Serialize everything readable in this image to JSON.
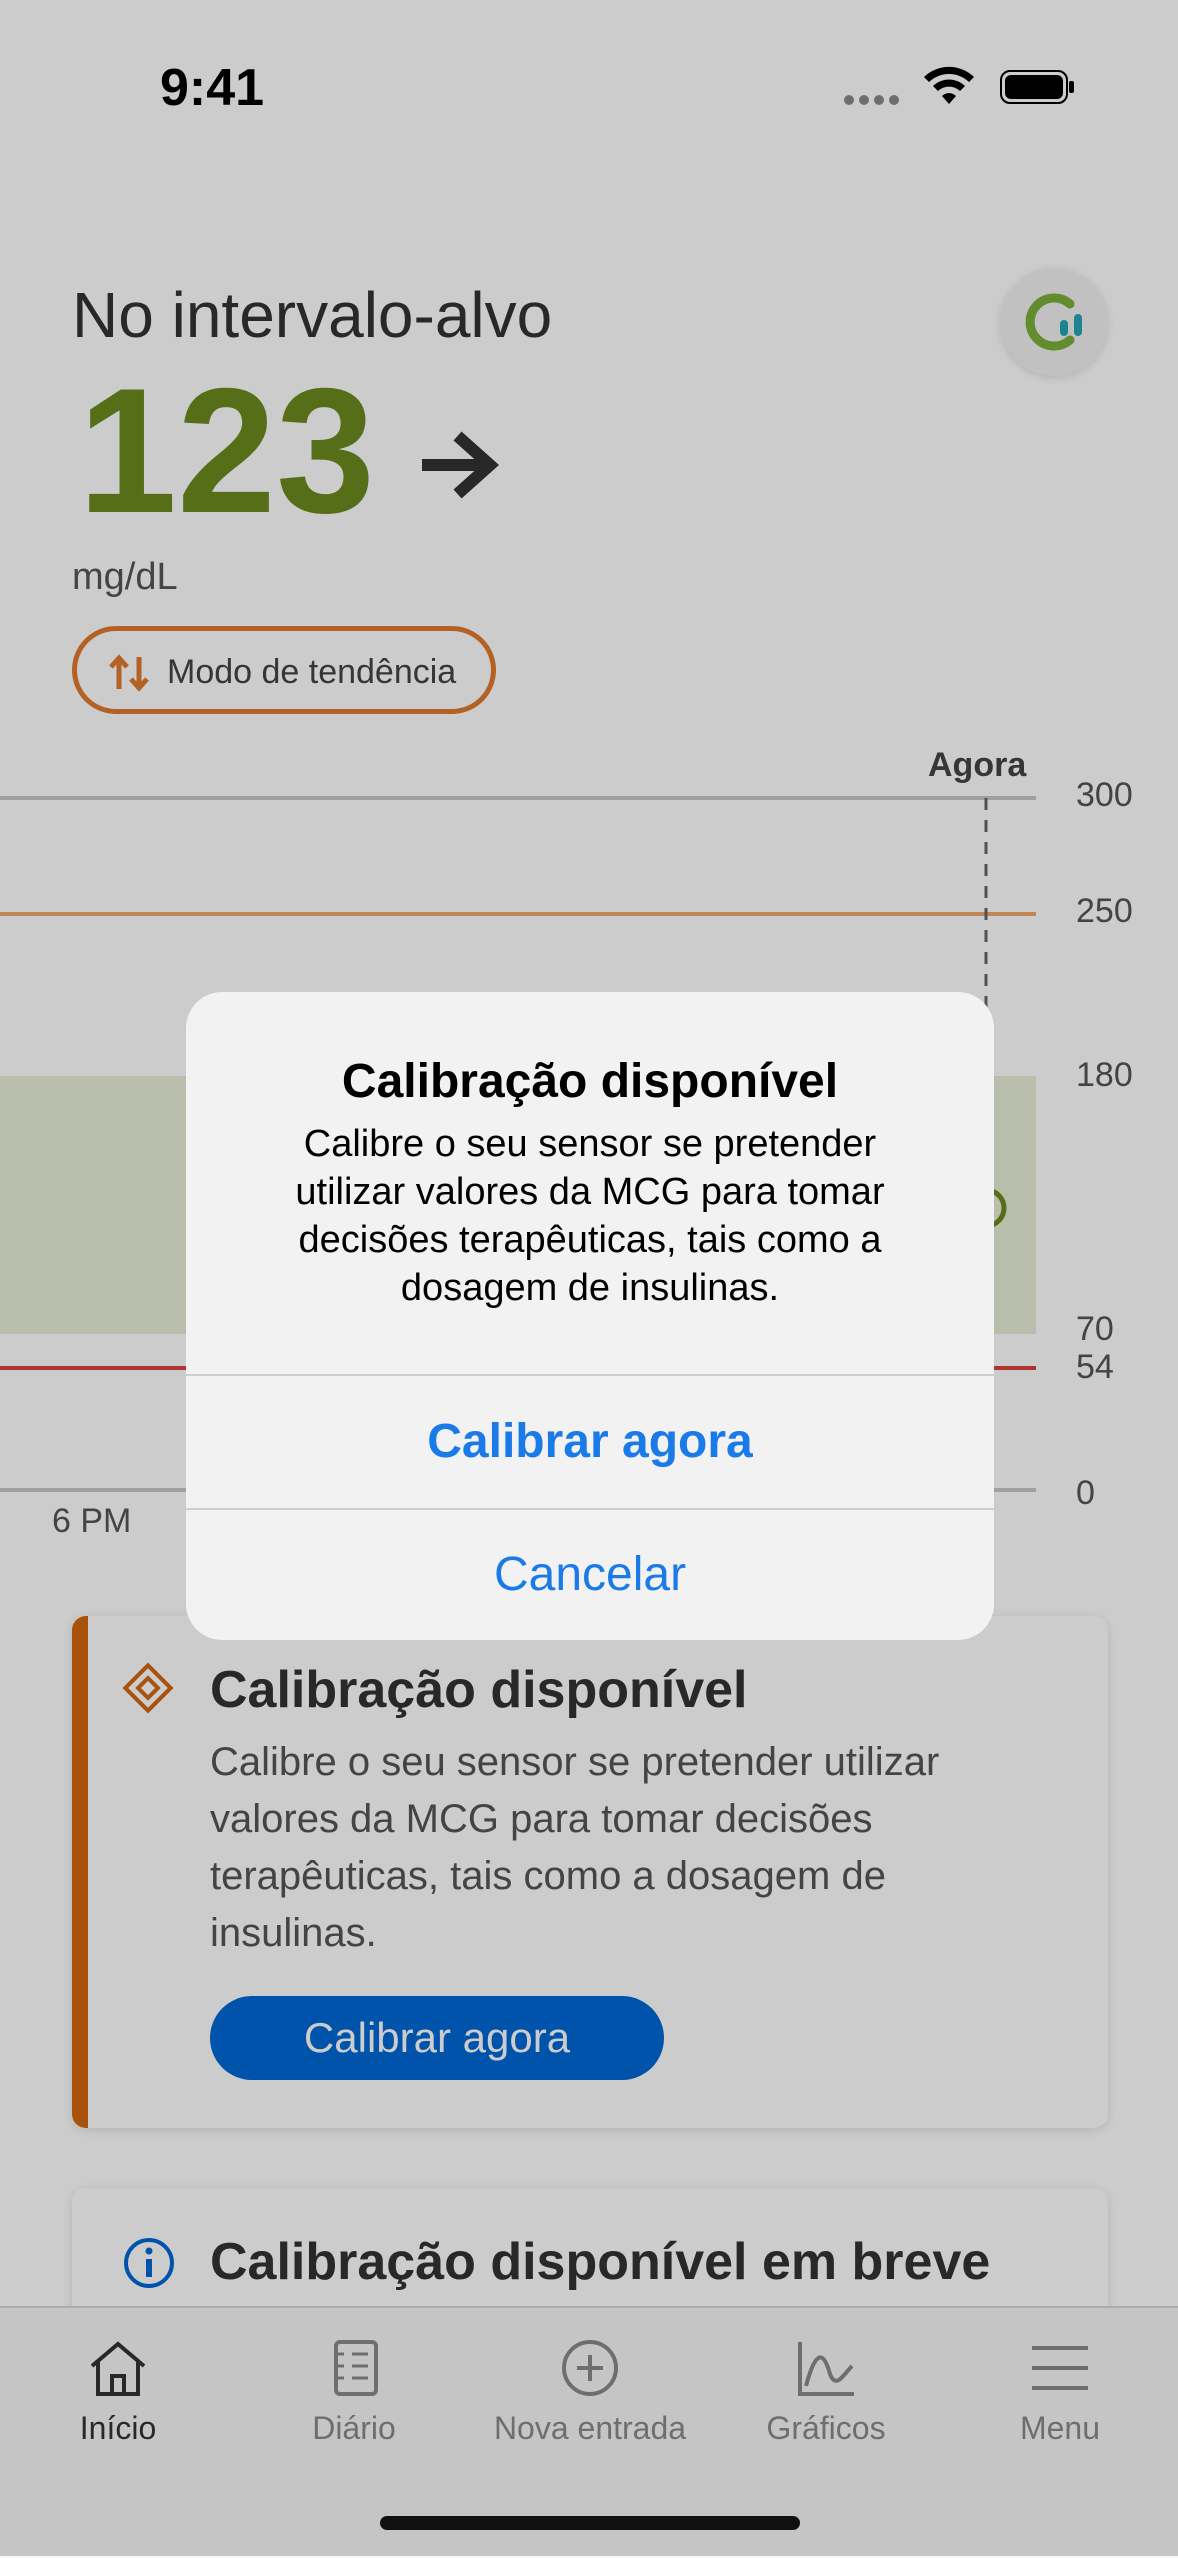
{
  "status_bar": {
    "time": "9:41"
  },
  "header": {
    "title": "No intervalo-alvo",
    "glucose_value": "123",
    "unit": "mg/dL",
    "trend_mode_label": "Modo de tendência"
  },
  "chart": {
    "now_label": "Agora",
    "x_label": "6 PM",
    "y_ticks": [
      "300",
      "250",
      "180",
      "70",
      "54",
      "0"
    ]
  },
  "chart_data": {
    "type": "line",
    "title": "",
    "xlabel": "",
    "ylabel": "",
    "ylim": [
      0,
      300
    ],
    "y_ticks": [
      300,
      250,
      180,
      70,
      54,
      0
    ],
    "x_ticks": [
      "6 PM"
    ],
    "now_marker": "Agora",
    "target_range": [
      70,
      180
    ],
    "high_threshold": 250,
    "low_threshold": 54,
    "current_value": 123,
    "unit": "mg/dL"
  },
  "cards": [
    {
      "title": "Calibração disponível",
      "body": "Calibre o seu sensor se pretender utilizar valores da MCG para tomar decisões terapêuticas, tais como a dosagem de insulinas.",
      "button": "Calibrar agora"
    },
    {
      "title": "Calibração disponível em breve"
    }
  ],
  "tabbar": {
    "items": [
      {
        "label": "Início",
        "icon": "home-icon"
      },
      {
        "label": "Diário",
        "icon": "diary-icon"
      },
      {
        "label": "Nova entrada",
        "icon": "plus-circle-icon"
      },
      {
        "label": "Gráficos",
        "icon": "chart-icon"
      },
      {
        "label": "Menu",
        "icon": "menu-icon"
      }
    ]
  },
  "alert": {
    "title": "Calibração disponível",
    "message": "Calibre o seu sensor se pretender utilizar valores da MCG para tomar decisões terapêuticas, tais como a dosagem de insulinas.",
    "primary_button": "Calibrar agora",
    "secondary_button": "Cancelar"
  },
  "colors": {
    "in_range_green": "#6d8a1f",
    "trend_orange": "#e07a2e",
    "card_accent": "#d2670e",
    "button_blue": "#0068d6",
    "alert_blue": "#1a7be8",
    "low_red": "#d9423c",
    "high_orange": "#f0a86a"
  }
}
